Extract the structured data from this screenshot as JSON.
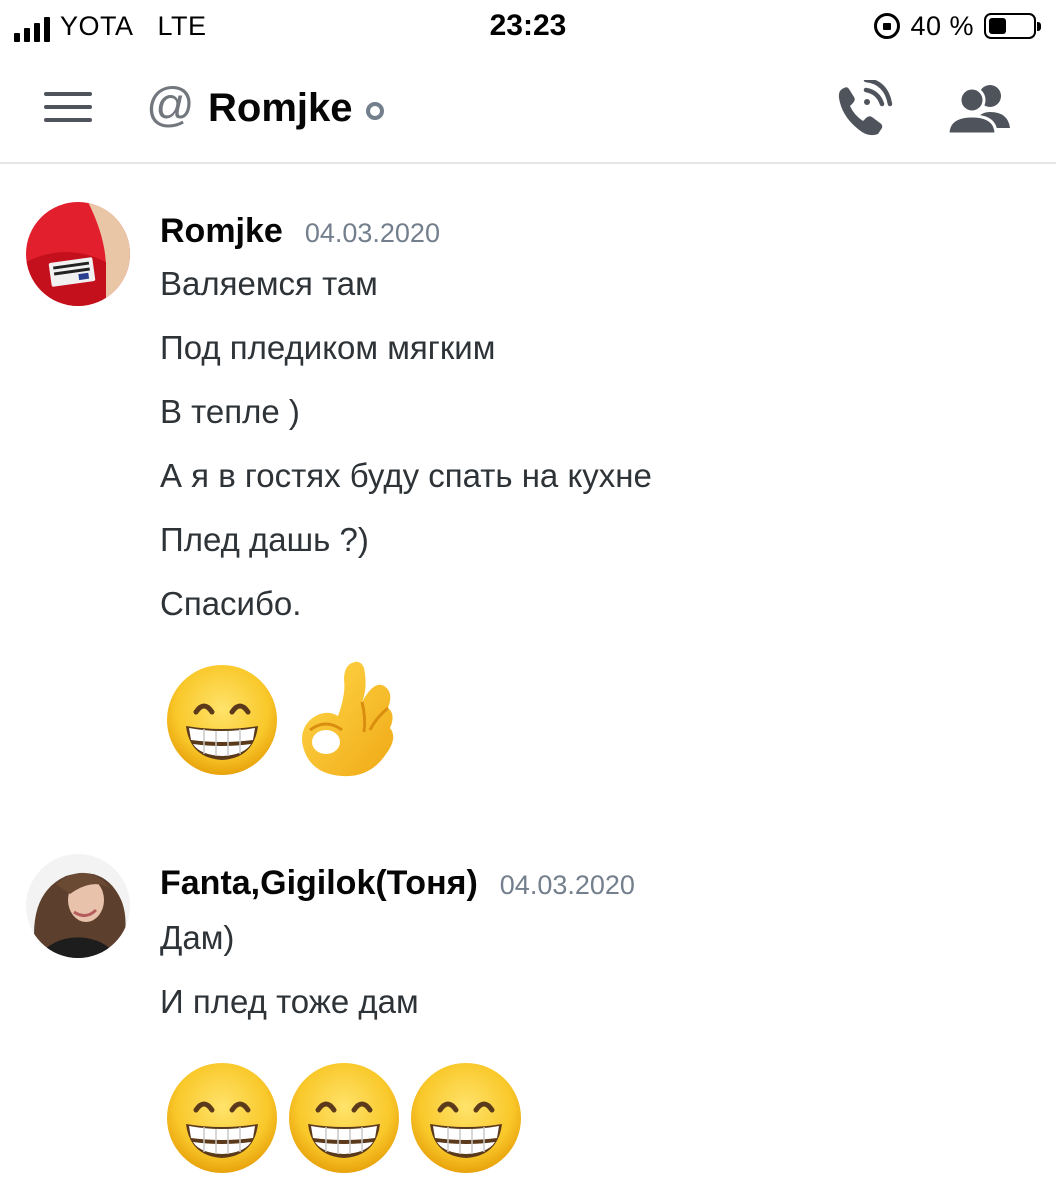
{
  "status_bar": {
    "carrier": "YOTA",
    "network": "LTE",
    "time": "23:23",
    "battery_text": "40 %",
    "battery_level": 0.4
  },
  "header": {
    "channel_name": "Romjke",
    "at_symbol": "@",
    "icons": [
      "menu-icon",
      "at-icon",
      "online-status-icon",
      "voice-call-icon",
      "members-icon"
    ]
  },
  "messages": [
    {
      "author": "Romjke",
      "timestamp": "04.03.2020",
      "lines": [
        "Валяемся там",
        "Под пледиком мягким",
        "В тепле )",
        "А я в гостях буду спать на кухне",
        "Плед дашь ?)",
        "Спасибо."
      ],
      "emojis": [
        "grinning-face-emoji",
        "ok-hand-emoji"
      ]
    },
    {
      "author": "Fanta,Gigilok(Тоня)",
      "timestamp": "04.03.2020",
      "lines": [
        "Дам)",
        "И плед тоже дам"
      ],
      "emojis": [
        "grinning-face-emoji",
        "grinning-face-emoji",
        "grinning-face-emoji"
      ]
    }
  ]
}
